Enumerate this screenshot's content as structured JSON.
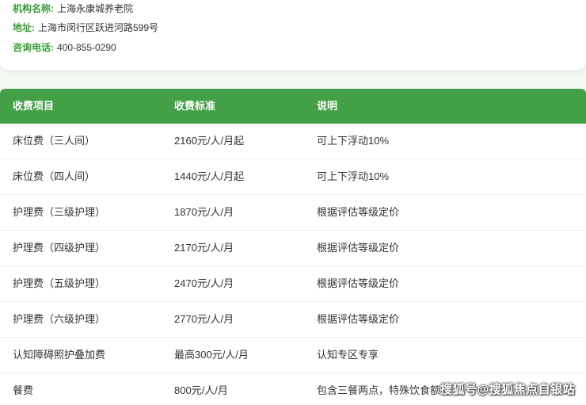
{
  "info": {
    "name_label": "机构名称:",
    "name_value": "上海永康城养老院",
    "address_label": "地址:",
    "address_value": "上海市闵行区跃进河路599号",
    "phone_label": "咨询电话:",
    "phone_value": "400-855-0290"
  },
  "fee_table": {
    "headers": [
      "收费项目",
      "收费标准",
      "说明"
    ],
    "rows": [
      {
        "item": "床位费（三人间）",
        "standard": "2160元/人/月起",
        "note": "可上下浮动10%"
      },
      {
        "item": "床位费（四人间）",
        "standard": "1440元/人/月起",
        "note": "可上下浮动10%"
      },
      {
        "item": "护理费（三级护理）",
        "standard": "1870元/人/月",
        "note": "根据评估等级定价"
      },
      {
        "item": "护理费（四级护理）",
        "standard": "2170元/人/月",
        "note": "根据评估等级定价"
      },
      {
        "item": "护理费（五级护理）",
        "standard": "2470元/人/月",
        "note": "根据评估等级定价"
      },
      {
        "item": "护理费（六级护理）",
        "standard": "2770元/人/月",
        "note": "根据评估等级定价"
      },
      {
        "item": "认知障碍照护叠加费",
        "standard": "最高300元/人/月",
        "note": "认知专区专享"
      },
      {
        "item": "餐费",
        "standard": "800元/人/月",
        "note": "包含三餐两点，特殊饮食额外"
      }
    ]
  },
  "watermark": "搜狐号@搜狐焦点自银站",
  "colors": {
    "accent_green": "#43a047",
    "label_green": "#3a9d3a"
  }
}
